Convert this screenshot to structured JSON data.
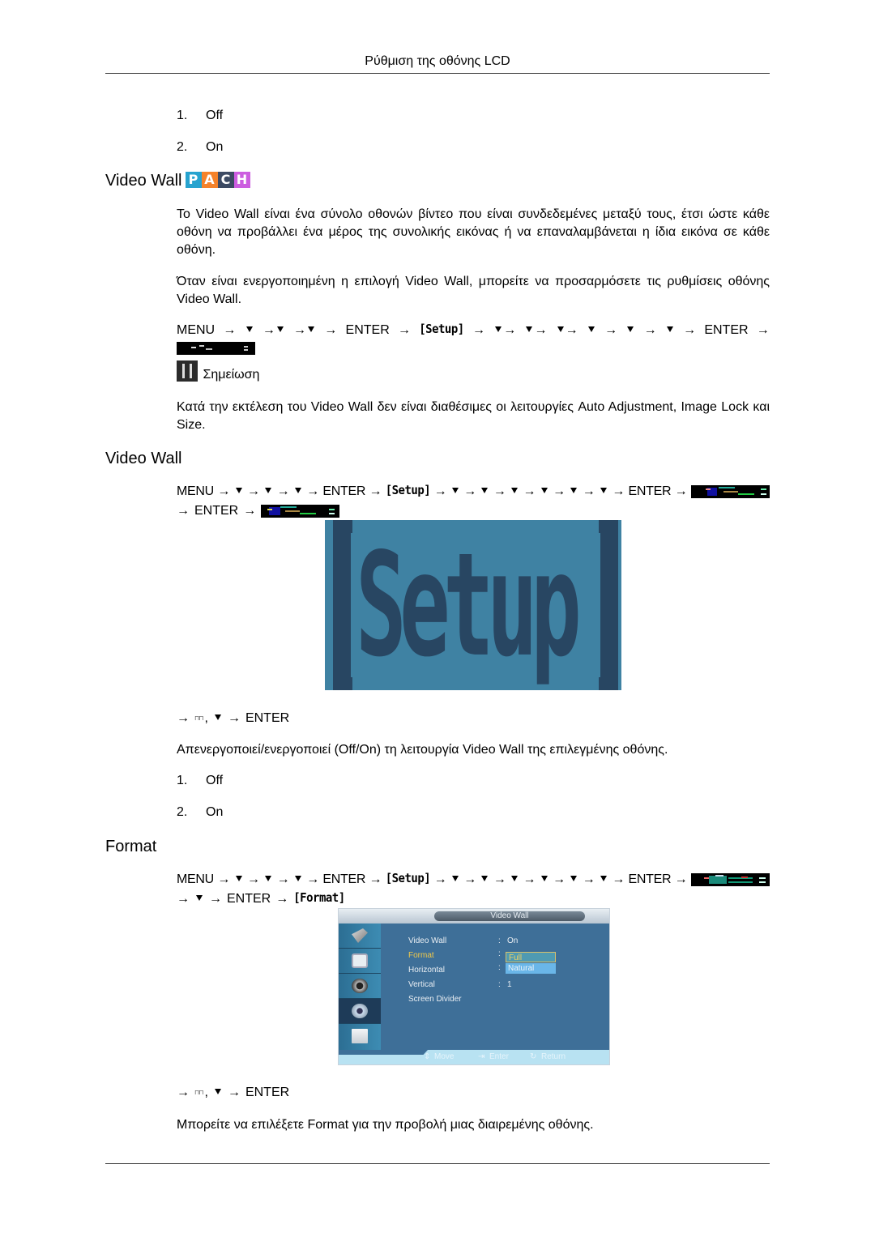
{
  "header": {
    "title": "Ρύθμιση της οθόνης LCD"
  },
  "list_top": [
    {
      "num": "1.",
      "label": "Off"
    },
    {
      "num": "2.",
      "label": "On"
    }
  ],
  "section1": {
    "title": "Video Wall",
    "badges": [
      {
        "letter": "P",
        "color": "#27a3cf"
      },
      {
        "letter": "A",
        "color": "#f5822a"
      },
      {
        "letter": "C",
        "color": "#3c4a63"
      },
      {
        "letter": "H",
        "color": "#cc5de0"
      }
    ],
    "para1": {
      "pre": "Το ",
      "term": "Video Wall",
      "post": " είναι ένα σύνολο οθονών βίντεο που είναι συνδεδεμένες μεταξύ τους, έτσι ώστε κάθε οθόνη να προβάλλει ένα μέρος της συνολικής εικόνας ή να επαναλαμβάνεται η ίδια εικόνα σε κάθε οθόνη."
    },
    "para2": {
      "pre": "Όταν είναι ενεργοποιημένη η επιλογή ",
      "term": "Video Wall",
      "mid": ", μπορείτε να προσαρμόσετε τις ρυθμίσεις οθόνης ",
      "term2": "Video Wall",
      "post": "."
    },
    "sequence": {
      "menu": "MENU",
      "arrow": "→",
      "enter": "ENTER",
      "setup": "[Setup]"
    },
    "note": {
      "label": "Σημείωση",
      "text_pre": "Κατά την εκτέλεση του ",
      "term1": "Video Wall",
      "text_mid": " δεν είναι διαθέσιμες οι λειτουργίες ",
      "term2": "Auto Adjustment",
      "comma": ", ",
      "term3": "Image Lock",
      "and": " και ",
      "term4": "Size",
      "end": "."
    }
  },
  "section2": {
    "title": "Video Wall",
    "sequence": {
      "menu": "MENU",
      "arrow": "→",
      "enter": "ENTER",
      "setup": "[Setup]"
    },
    "image_text": "[Setup]",
    "nav_line": {
      "arrow": "→",
      "comma": ",",
      "enter": "ENTER"
    },
    "description": {
      "pre": "Απενεργοποιεί/ενεργοποιεί (Off/On) τη λειτουργία ",
      "term": "Video Wall",
      "post": " της επιλεγμένης οθόνης."
    },
    "list": [
      {
        "num": "1.",
        "label": "Off"
      },
      {
        "num": "2.",
        "label": "On"
      }
    ]
  },
  "section3": {
    "title": "Format",
    "sequence": {
      "menu": "MENU",
      "arrow": "→",
      "enter": "ENTER",
      "setup": "[Setup]",
      "format": "[Format]"
    },
    "osd": {
      "title": "Video Wall",
      "rows": [
        {
          "label": "Video Wall",
          "value": "On"
        },
        {
          "label": "Format",
          "value": ""
        },
        {
          "label": "Horizontal",
          "value": ""
        },
        {
          "label": "Vertical",
          "value": "1"
        },
        {
          "label": "Screen Divider",
          "value": ""
        }
      ],
      "separator": ":",
      "dropdown": [
        "Full",
        "Natural"
      ],
      "selected": "Full",
      "footer": {
        "move": "Move",
        "enter": "Enter",
        "return": "Return"
      }
    },
    "nav_line": {
      "arrow": "→",
      "comma": ",",
      "enter": "ENTER"
    },
    "description": {
      "pre": "Μπορείτε να επιλέξετε ",
      "term": "Format",
      "post": " για την προβολή μιας διαιρεμένης οθόνης."
    }
  }
}
